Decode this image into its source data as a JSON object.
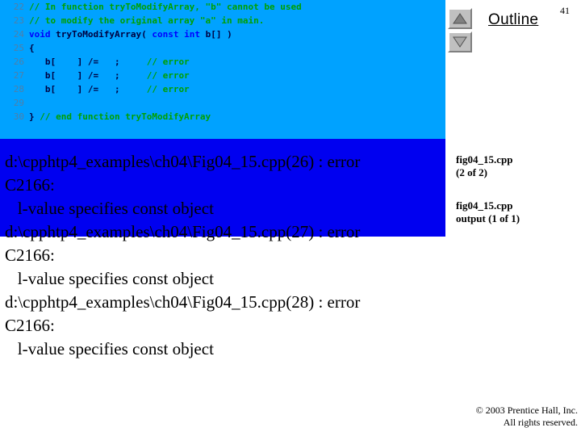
{
  "slide": {
    "page_number": "41",
    "outline_label": "Outline",
    "background_color": "#ffffff"
  },
  "colors": {
    "code_panel_bg": "#00a2ff",
    "output_block_bg": "#0000f0",
    "comment": "#00a000",
    "keyword": "#0000ff",
    "identifier": "#000040",
    "line_number": "#4f7fa8"
  },
  "scroll_buttons": {
    "up_icon": "triangle-up-icon",
    "down_icon": "triangle-down-icon"
  },
  "code": {
    "lines": [
      {
        "n": "22",
        "tokens": [
          {
            "t": "// In function tryToModifyArray, \"b\" cannot be used",
            "c": "cmt"
          }
        ]
      },
      {
        "n": "23",
        "tokens": [
          {
            "t": "// to modify the original array \"a\" in main.",
            "c": "cmt"
          }
        ]
      },
      {
        "n": "24",
        "tokens": [
          {
            "t": "void ",
            "c": "kw"
          },
          {
            "t": "tryToModifyArray( ",
            "c": "id"
          },
          {
            "t": "const int ",
            "c": "kw"
          },
          {
            "t": "b[] )",
            "c": "id"
          }
        ]
      },
      {
        "n": "25",
        "tokens": [
          {
            "t": "{",
            "c": "id"
          }
        ]
      },
      {
        "n": "26",
        "tokens": [
          {
            "t": "   b[    ] /=   ;     ",
            "c": "id"
          },
          {
            "t": "// error",
            "c": "cmt"
          }
        ]
      },
      {
        "n": "27",
        "tokens": [
          {
            "t": "   b[    ] /=   ;     ",
            "c": "id"
          },
          {
            "t": "// error",
            "c": "cmt"
          }
        ]
      },
      {
        "n": "28",
        "tokens": [
          {
            "t": "   b[    ] /=   ;     ",
            "c": "id"
          },
          {
            "t": "// error",
            "c": "cmt"
          }
        ]
      },
      {
        "n": "29",
        "tokens": [
          {
            "t": "",
            "c": "id"
          }
        ]
      },
      {
        "n": "30",
        "tokens": [
          {
            "t": "} ",
            "c": "id"
          },
          {
            "t": "// end function tryToModifyArray",
            "c": "cmt"
          }
        ]
      }
    ]
  },
  "compiler_output": {
    "text": "d:\\cpphtp4_examples\\ch04\\Fig04_15.cpp(26) : error\nC2166:\n   l-value specifies const object\nd:\\cpphtp4_examples\\ch04\\Fig04_15.cpp(27) : error\nC2166:\n   l-value specifies const object\nd:\\cpphtp4_examples\\ch04\\Fig04_15.cpp(28) : error\nC2166:\n   l-value specifies const object"
  },
  "captions": {
    "first": "fig04_15.cpp\n(2 of 2)",
    "second": "fig04_15.cpp\noutput (1 of 1)"
  },
  "footer": {
    "text": "© 2003 Prentice Hall, Inc.\nAll rights reserved."
  }
}
